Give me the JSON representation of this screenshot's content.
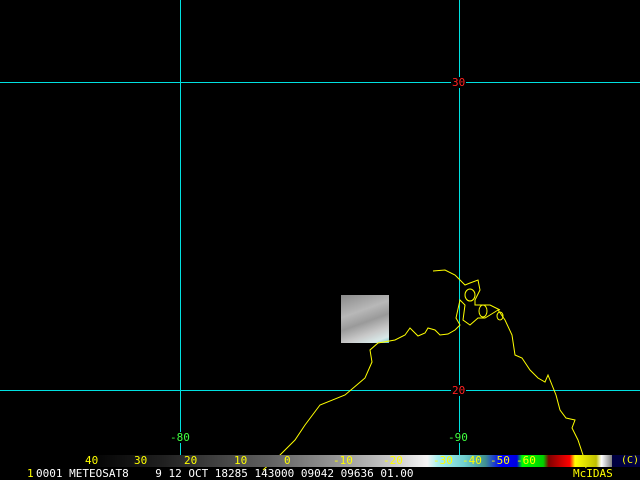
{
  "grid": {
    "lat_labels": [
      "30",
      "20"
    ],
    "lon_labels": [
      "-80",
      "-90"
    ],
    "line_color": "#00e0e0"
  },
  "colorbar": {
    "labels": [
      "40",
      "30",
      "20",
      "10",
      "0",
      "-10",
      "-20",
      "-30",
      "-40",
      "-50",
      "-60"
    ],
    "corner": "(C)"
  },
  "status": {
    "frame": "1",
    "text": "0001 METEOSAT8    9 12 OCT 18285 143000 09042 09636 01.00",
    "brand": "McIDAS"
  }
}
